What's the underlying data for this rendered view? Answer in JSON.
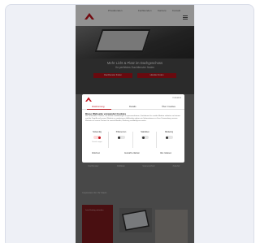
{
  "site": {
    "topnav": [
      "Privatkunden",
      "Fachkunden",
      "Karriere",
      "Kontakt"
    ],
    "hero": {
      "title": "Mehr Licht & Platz im Dachgeschoss",
      "subtitle": "Ihr perfektes Dachfenster finden",
      "buttons": [
        "Dachfenster finden",
        "Händler finden"
      ]
    },
    "tiles": [
      "Dachfenster",
      "Rollläden",
      "Sonnenschutz",
      "Zubehör"
    ],
    "section_title": "Inspiration für Ihr Dach",
    "red_card_text": "Jetzt Katalog anfordern"
  },
  "consent": {
    "powered_by": "Cookiebot",
    "tabs": [
      "Zustimmung",
      "Details",
      "Über Cookies"
    ],
    "heading": "Diese Webseite verwendet Cookies",
    "text": "Wir verwenden Cookies, um Inhalte und Anzeigen zu personalisieren, Funktionen für soziale Medien anbieten zu können und die Zugriffe auf unsere Website zu analysieren. Außerdem geben wir Informationen zu Ihrer Verwendung unserer Website an unsere Partner für soziale Medien, Werbung und Analysen weiter.",
    "categories": [
      {
        "label": "Notwendig",
        "state": "on"
      },
      {
        "label": "Präferenzen",
        "state": "off"
      },
      {
        "label": "Statistiken",
        "state": "off"
      },
      {
        "label": "Marketing",
        "state": "off"
      }
    ],
    "details_link": "Details zeigen",
    "actions": {
      "deny": "Ablehnen",
      "allow_selection": "Auswahl erlauben",
      "allow_all": "Alle zulassen"
    }
  },
  "colors": {
    "brand_red": "#b5121b",
    "frame_bg": "#eef0f6"
  }
}
